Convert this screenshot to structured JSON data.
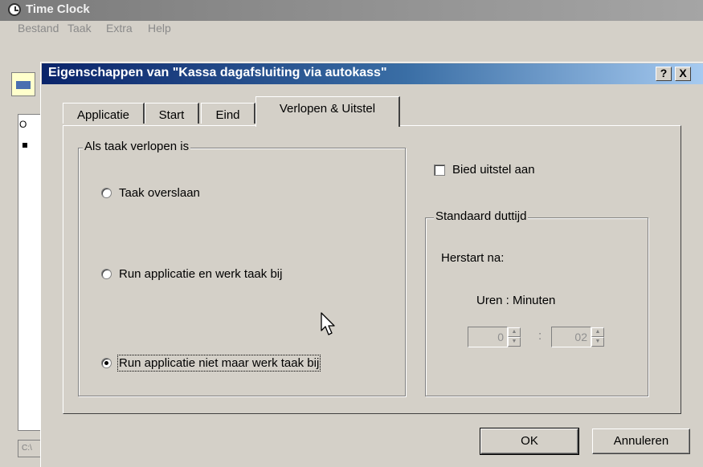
{
  "bg_window": {
    "title": "Time Clock",
    "menu": [
      "Bestand",
      "Taak",
      "Extra",
      "Help"
    ],
    "list_header": "O",
    "status_text": "C:\\"
  },
  "dialog": {
    "title": "Eigenschappen van \"Kassa dagafsluiting via autokass\"",
    "help_button": "?",
    "close_button": "X",
    "tabs": [
      {
        "label": "Applicatie",
        "active": false
      },
      {
        "label": "Start",
        "active": false
      },
      {
        "label": "Eind",
        "active": false
      },
      {
        "label": "Verlopen & Uitstel",
        "active": true
      }
    ],
    "expired_group": {
      "label": "Als taak verlopen is",
      "options": [
        {
          "label": "Taak overslaan",
          "checked": false
        },
        {
          "label": "Run applicatie en werk taak bij",
          "checked": false
        },
        {
          "label": "Run applicatie niet maar werk taak bij",
          "checked": true
        }
      ]
    },
    "offer_postpone": {
      "label": "Bied uitstel aan",
      "checked": false
    },
    "snooze_group": {
      "label": "Standaard duttijd",
      "restart_label": "Herstart na:",
      "units_label": "Uren : Minuten",
      "separator": ":",
      "hours": "0",
      "minutes": "02"
    },
    "buttons": {
      "ok": "OK",
      "cancel": "Annuleren"
    }
  },
  "colors": {
    "titlebar_active_start": "#0a246a",
    "titlebar_active_end": "#a6caf0",
    "face": "#d4d0c8"
  },
  "icons": [
    "clock-icon",
    "toolbar-document-icon",
    "question-icon",
    "close-icon",
    "mouse-cursor-icon",
    "spin-up-icon",
    "spin-down-icon"
  ]
}
